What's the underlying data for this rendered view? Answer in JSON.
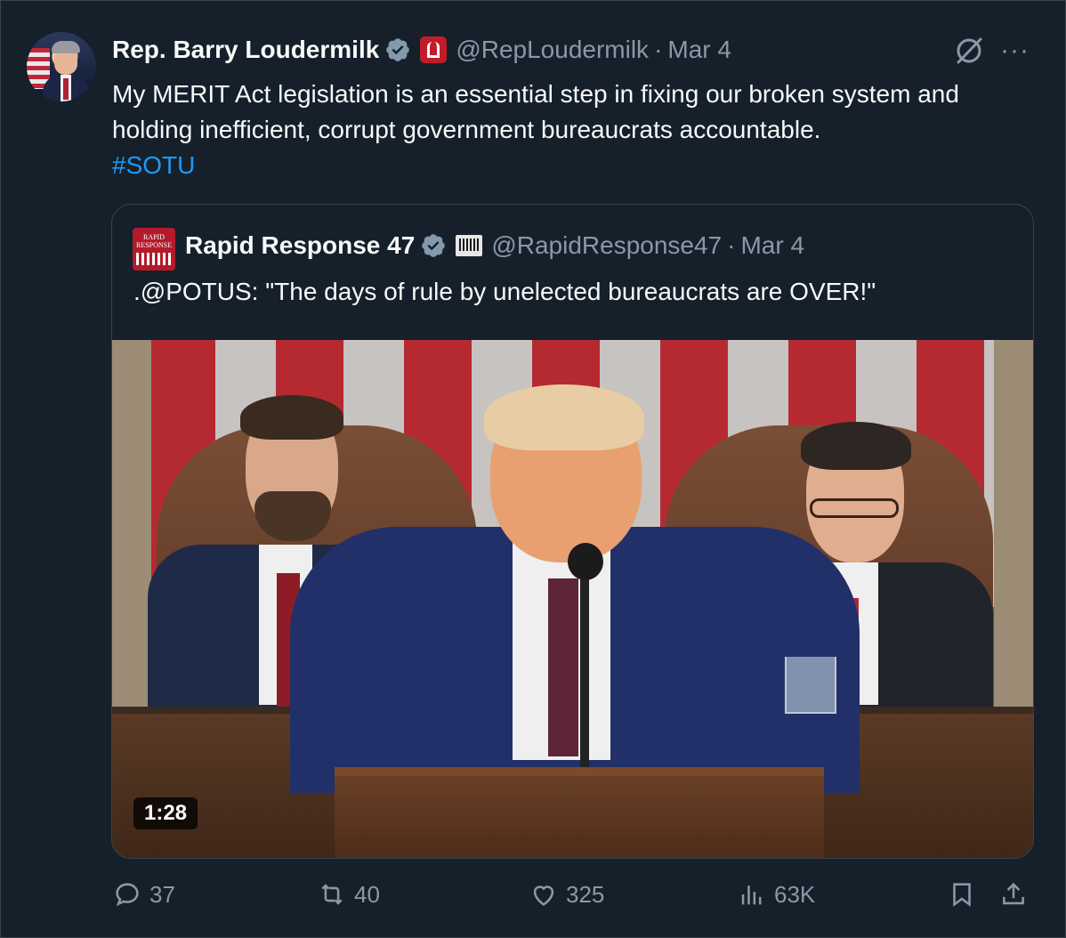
{
  "tweet": {
    "author_name": "Rep. Barry Loudermilk",
    "handle": "@RepLoudermilk",
    "separator": "·",
    "date": "Mar 4",
    "text": "My MERIT Act legislation is an essential step in fixing our broken system and holding inefficient, corrupt government bureaucrats accountable.",
    "hashtag": "#SOTU"
  },
  "quote": {
    "avatar_text": "RAPID RESPONSE",
    "author_name": "Rapid Response 47",
    "handle": "@RapidResponse47",
    "separator": "·",
    "date": "Mar 4",
    "text": ".@POTUS: \"The days of rule by unelected bureaucrats are OVER!\"",
    "video_duration": "1:28"
  },
  "actions": {
    "replies": "37",
    "reposts": "40",
    "likes": "325",
    "views": "63K"
  },
  "icons": {
    "verified": "verified-badge-icon",
    "government": "government-badge-icon",
    "grok": "grok-icon",
    "more": "more-icon",
    "reply": "reply-icon",
    "repost": "repost-icon",
    "like": "heart-icon",
    "views": "views-icon",
    "bookmark": "bookmark-icon",
    "share": "share-icon"
  },
  "colors": {
    "background": "#15202b",
    "text": "#f7f9f9",
    "muted": "#8b98a5",
    "link": "#1d9bf0",
    "border": "#38444d",
    "verified": "#829aab"
  }
}
